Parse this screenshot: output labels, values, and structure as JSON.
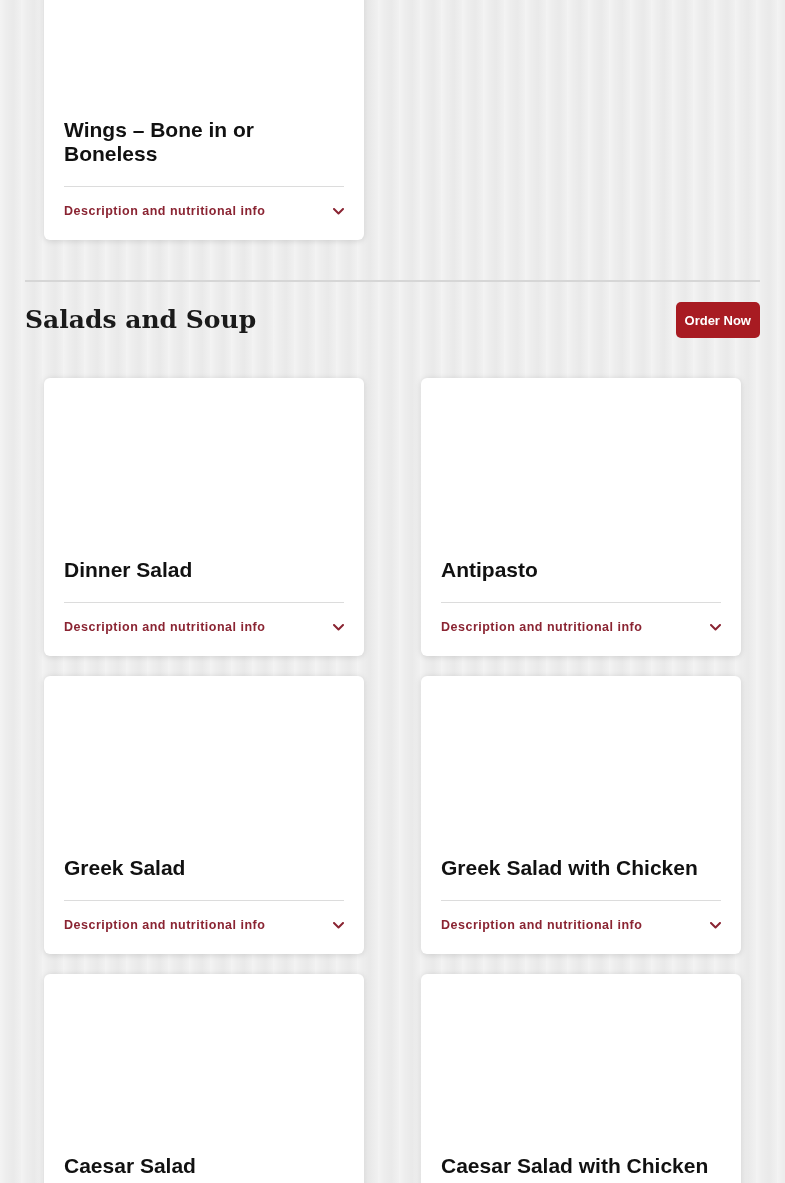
{
  "sections": [
    {
      "items": [
        {
          "name": "Wings – Bone in or Boneless",
          "details_label": "Description and nutritional info",
          "expanded": false
        }
      ]
    },
    {
      "title": "Salads and Soup",
      "order_button": "Order Now",
      "items": [
        {
          "name": "Dinner Salad",
          "details_label": "Description and nutritional info",
          "expanded": false
        },
        {
          "name": "Antipasto",
          "details_label": "Description and nutritional info",
          "expanded": false
        },
        {
          "name": "Greek Salad",
          "details_label": "Description and nutritional info",
          "expanded": false
        },
        {
          "name": "Greek Salad with Chicken",
          "details_label": "Description and nutritional info",
          "expanded": false
        },
        {
          "name": "Caesar Salad"
        },
        {
          "name": "Caesar Salad with Chicken"
        }
      ]
    }
  ]
}
